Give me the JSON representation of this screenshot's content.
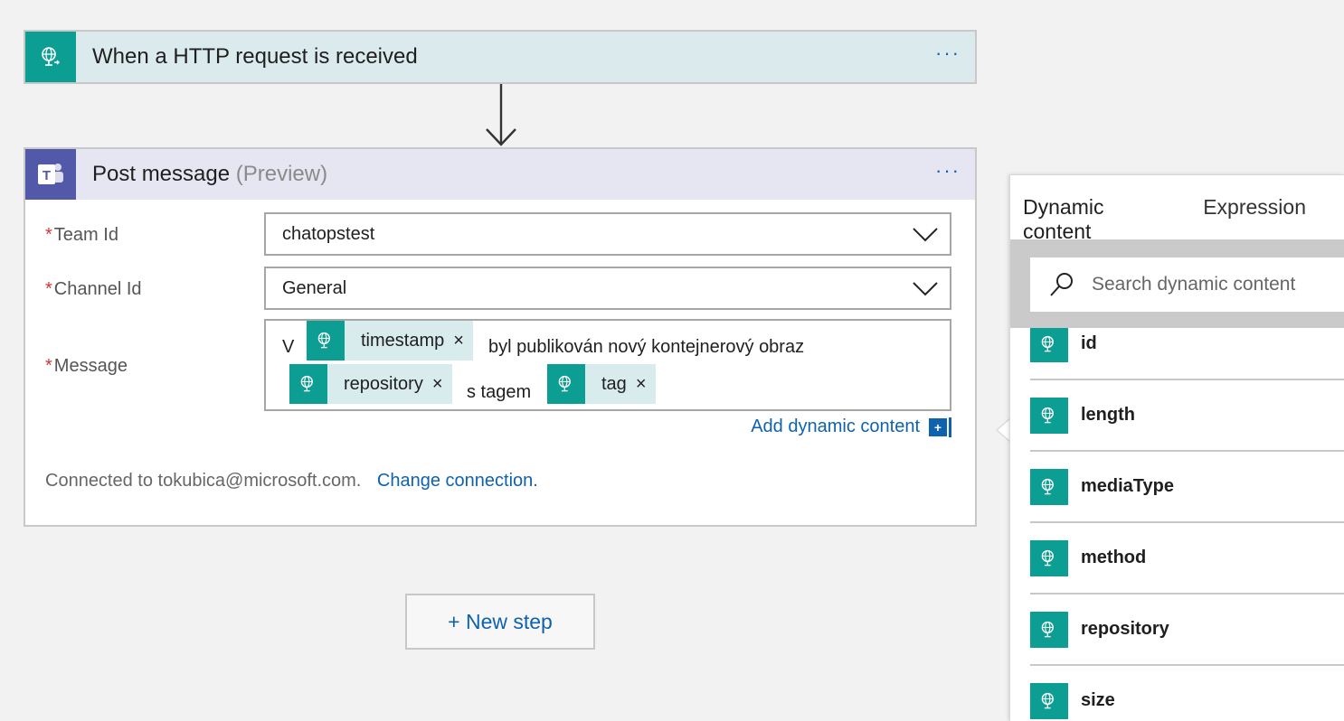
{
  "trigger": {
    "title": "When a HTTP request is received",
    "menu_label": "···",
    "icon": "http-globe-icon"
  },
  "action": {
    "title": "Post message",
    "subtitle": "(Preview)",
    "menu_label": "···",
    "icon": "teams-icon",
    "fields": {
      "team": {
        "required_mark": "*",
        "label": "Team Id",
        "value": "chatopstest"
      },
      "channel": {
        "required_mark": "*",
        "label": "Channel Id",
        "value": "General"
      },
      "message": {
        "required_mark": "*",
        "label": "Message",
        "text_1": "V",
        "token_1": "timestamp",
        "text_2": "byl publikován nový kontejnerový obraz",
        "token_2": "repository",
        "text_3": "s tagem",
        "token_3": "tag",
        "remove_glyph": "×"
      }
    },
    "add_dynamic_label": "Add dynamic content",
    "add_dynamic_plus": "+",
    "connection_text": "Connected to tokubica@microsoft.com.",
    "change_connection": "Change connection."
  },
  "new_step_label": "+ New step",
  "panel": {
    "tabs": [
      "Dynamic content",
      "Expression"
    ],
    "search_placeholder": "Search dynamic content",
    "items": [
      "id",
      "length",
      "mediaType",
      "method",
      "repository",
      "size"
    ]
  },
  "colors": {
    "teal": "#0c9e93",
    "teams_purple": "#5259a8",
    "link_blue": "#0f62ad",
    "required_red": "#d13438"
  }
}
